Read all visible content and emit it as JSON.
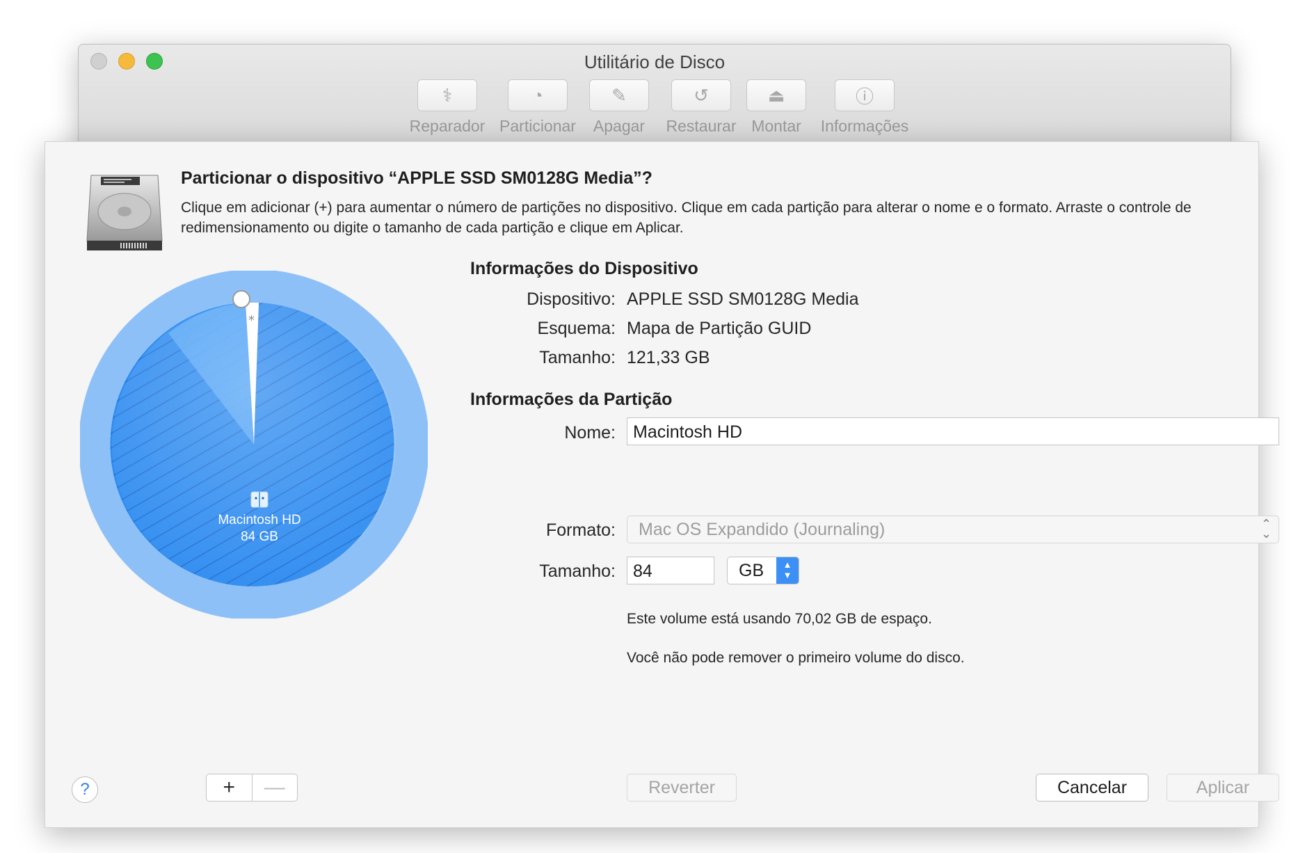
{
  "window": {
    "title": "Utilitário de Disco",
    "toolbar": [
      {
        "label": "Reparador",
        "icon": "stethoscope-icon",
        "glyph": "⚕"
      },
      {
        "label": "Particionar",
        "icon": "pie-partition-icon",
        "glyph": "◔"
      },
      {
        "label": "Apagar",
        "icon": "erase-icon",
        "glyph": "✎"
      },
      {
        "label": "Restaurar",
        "icon": "restore-icon",
        "glyph": "↺"
      },
      {
        "label": "Montar",
        "icon": "mount-icon",
        "glyph": "⏏"
      },
      {
        "label": "Informações",
        "icon": "info-icon",
        "glyph": "ⓘ"
      }
    ]
  },
  "sheet": {
    "heading": "Particionar o dispositivo “APPLE SSD SM0128G Media”?",
    "description": "Clique em adicionar (+) para aumentar o número de partições no dispositivo. Clique em cada partição para alterar o nome e o formato. Arraste o controle de redimensionamento ou digite o tamanho de cada partição e clique em Aplicar.",
    "pie": {
      "partition_name": "Macintosh HD",
      "partition_size": "84 GB",
      "asterisk": "*",
      "slice_fraction": 0.99,
      "color": "#2f8cf0"
    },
    "device_info": {
      "title": "Informações do Dispositivo",
      "device_label": "Dispositivo:",
      "device_value": "APPLE SSD SM0128G Media",
      "scheme_label": "Esquema:",
      "scheme_value": "Mapa de Partição GUID",
      "size_label": "Tamanho:",
      "size_value": "121,33 GB"
    },
    "partition_info": {
      "title": "Informações da Partição",
      "name_label": "Nome:",
      "name_value": "Macintosh HD",
      "format_label": "Formato:",
      "format_value": "Mac OS Expandido (Journaling)",
      "size_label": "Tamanho:",
      "size_value": "84",
      "unit_value": "GB",
      "note_usage": "Este volume está usando 70,02 GB de espaço.",
      "note_remove": "Você não pode remover o primeiro volume do disco."
    },
    "buttons": {
      "help": "?",
      "add": "+",
      "remove": "—",
      "revert": "Reverter",
      "cancel": "Cancelar",
      "apply": "Aplicar"
    }
  },
  "colors": {
    "accent": "#3b8ff5",
    "pie_fill": "#2f8cf0"
  }
}
